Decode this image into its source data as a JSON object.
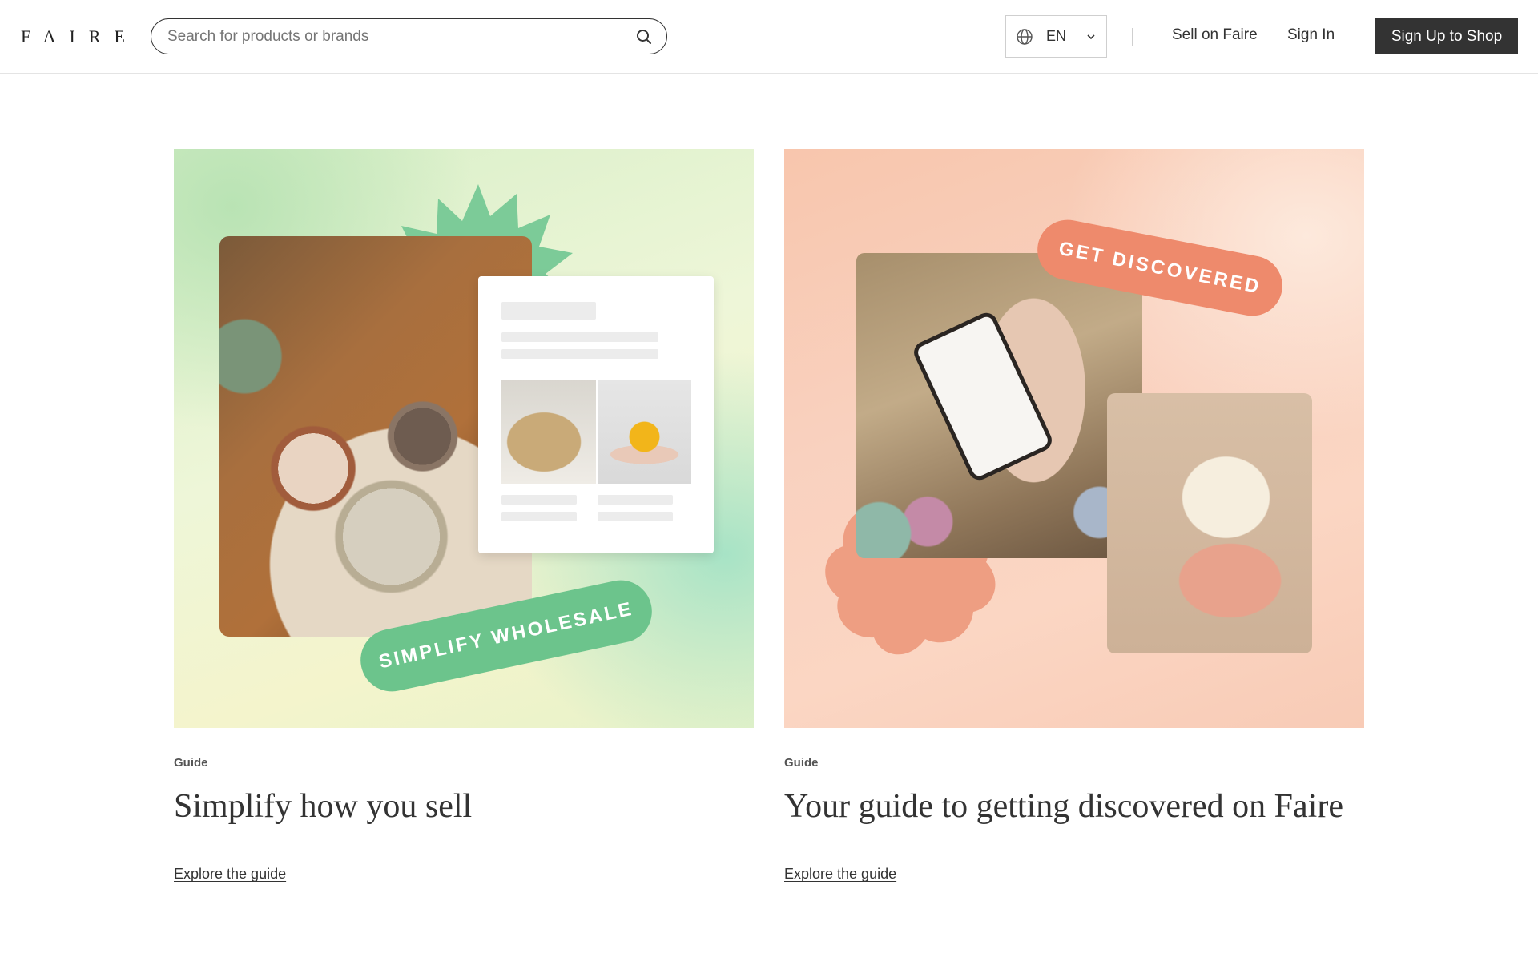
{
  "header": {
    "logo_text": "FAIRE",
    "search": {
      "placeholder": "Search for products or brands",
      "value": "",
      "icon": "search-icon"
    },
    "language": {
      "icon": "globe-icon",
      "code": "EN",
      "chevron_icon": "chevron-down-icon"
    },
    "links": {
      "sell": "Sell on Faire",
      "sign_in": "Sign In"
    },
    "cta": "Sign Up to Shop",
    "colors": {
      "cta_bg": "#333333",
      "cta_text": "#ffffff"
    }
  },
  "cards": [
    {
      "image_badge": "SIMPLIFY WHOLESALE",
      "meta": "Guide",
      "title": "Simplify how you sell",
      "link": "Explore the guide",
      "accent_color": "#6cc48c"
    },
    {
      "image_badge": "GET DISCOVERED",
      "meta": "Guide",
      "title": "Your guide to getting discovered on Faire",
      "link": "Explore the guide",
      "accent_color": "#ee8a6c"
    }
  ]
}
